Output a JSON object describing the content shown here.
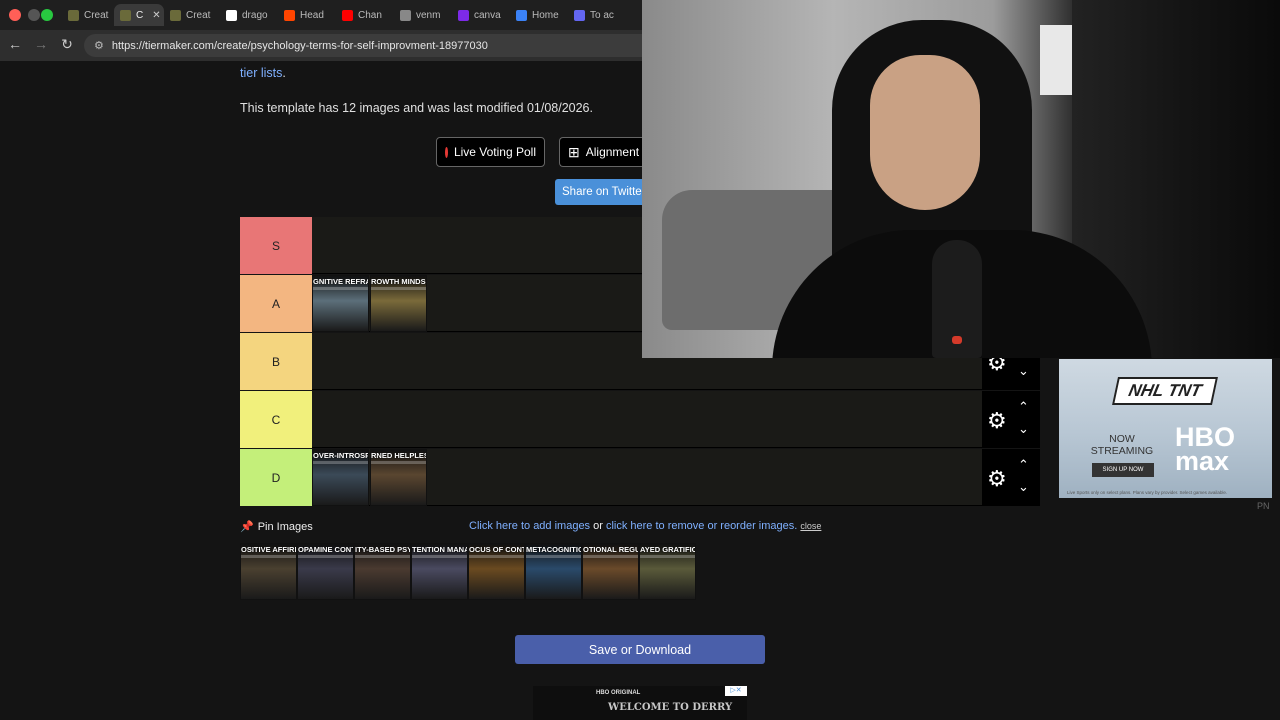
{
  "browser": {
    "tabs": [
      {
        "label": "Creat",
        "active": false,
        "favicon_color": "#6a6a3a"
      },
      {
        "label": "C",
        "active": true,
        "favicon_color": "#6a6a3a"
      },
      {
        "label": "Creat",
        "active": false,
        "favicon_color": "#6a6a3a"
      },
      {
        "label": "drago",
        "active": false,
        "favicon_color": "#ffffff"
      },
      {
        "label": "Head",
        "active": false,
        "favicon_color": "#ff4500"
      },
      {
        "label": "Chan",
        "active": false,
        "favicon_color": "#ff0000"
      },
      {
        "label": "venm",
        "active": false,
        "favicon_color": "#888888"
      },
      {
        "label": "canva",
        "active": false,
        "favicon_color": "#7d2ae8"
      },
      {
        "label": "Home",
        "active": false,
        "favicon_color": "#3b82f6"
      },
      {
        "label": "To ac",
        "active": false,
        "favicon_color": "#6366f1"
      }
    ],
    "url": "https://tiermaker.com/create/psychology-terms-for-self-improvment-18977030"
  },
  "page": {
    "tier_lists_link": "tier lists",
    "template_info": "This template has 12 images and was last modified 01/08/2026.",
    "live_voting_label": "Live Voting Poll",
    "alignment_label": "Alignment C",
    "share_label": "Share on Twitter"
  },
  "tiers": [
    {
      "label": "S",
      "color": "#e87676",
      "items": []
    },
    {
      "label": "A",
      "color": "#f3b681",
      "items": [
        {
          "caption": "GNITIVE REFRAM",
          "tone": "#5c6f7a"
        },
        {
          "caption": "ROWTH MINDSE",
          "tone": "#7a6a3a"
        }
      ]
    },
    {
      "label": "B",
      "color": "#f4d57f",
      "items": []
    },
    {
      "label": "C",
      "color": "#f1f07c",
      "items": []
    },
    {
      "label": "D",
      "color": "#c4ef7a",
      "items": [
        {
          "caption": "OVER-INTROSPECTIO",
          "tone": "#3b4a58"
        },
        {
          "caption": "RNED HELPLESSNE",
          "tone": "#5a4630"
        }
      ]
    }
  ],
  "pool": {
    "pin_label": "Pin Images",
    "add_link": "Click here to add images",
    "or_text": "or",
    "remove_link": "click here to remove or reorder images.",
    "close_label": "close",
    "items": [
      {
        "caption": "OSITIVE AFFIRMATIO",
        "tone": "#4a4030"
      },
      {
        "caption": "OPAMINE CONTRO",
        "tone": "#3a3a4a"
      },
      {
        "caption": "ITY-BASED PSYCH",
        "tone": "#4a3a30"
      },
      {
        "caption": "TENTION MANAGEM",
        "tone": "#4a4a60"
      },
      {
        "caption": "OCUS OF CONTRO",
        "tone": "#6a4a20"
      },
      {
        "caption": "METACOGNITION",
        "tone": "#2a4a6a"
      },
      {
        "caption": "OTIONAL REGULATI",
        "tone": "#6a4a2a"
      },
      {
        "caption": "AYED GRATIFICATI",
        "tone": "#5a5a3a"
      }
    ]
  },
  "save_label": "Save or Download",
  "ad_bottom": {
    "network": "HBO ORIGINAL",
    "title": "WELCOME TO DERRY"
  },
  "ad_right": {
    "nhl": "NHL TNT",
    "now_streaming": "NOW STREAMING",
    "signup": "SIGN UP NOW",
    "brand": "HBO max",
    "fine_print": "Live Sports only on select plans. Plans vary by provider. Select games available.",
    "corner": "PN"
  }
}
